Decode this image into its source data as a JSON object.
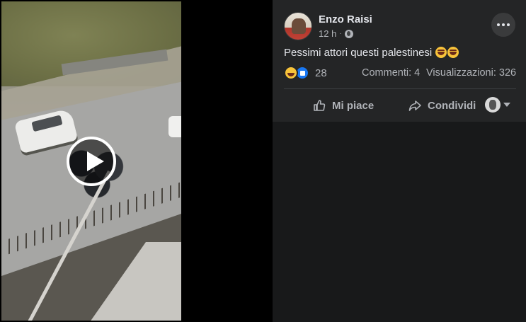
{
  "post": {
    "author": "Enzo Raisi",
    "time": "12 h",
    "text": "Pessimi attori questi palestinesi",
    "reactions_count": "28",
    "comments": "Commenti: 4",
    "views": "Visualizzazioni: 326"
  },
  "actions": {
    "like_label": "Mi piace",
    "share_label": "Condividi"
  },
  "icons": {
    "privacy": "globe-icon",
    "more": "more-options-icon",
    "reactions": [
      "haha-reaction-icon",
      "like-reaction-icon"
    ],
    "emoji_in_text": [
      "laughing-emoji",
      "laughing-emoji"
    ]
  },
  "colors": {
    "background": "#18191a",
    "panel": "#242526",
    "primary_text": "#e4e6eb",
    "secondary_text": "#b0b3b8",
    "like_blue": "#1877f2"
  }
}
